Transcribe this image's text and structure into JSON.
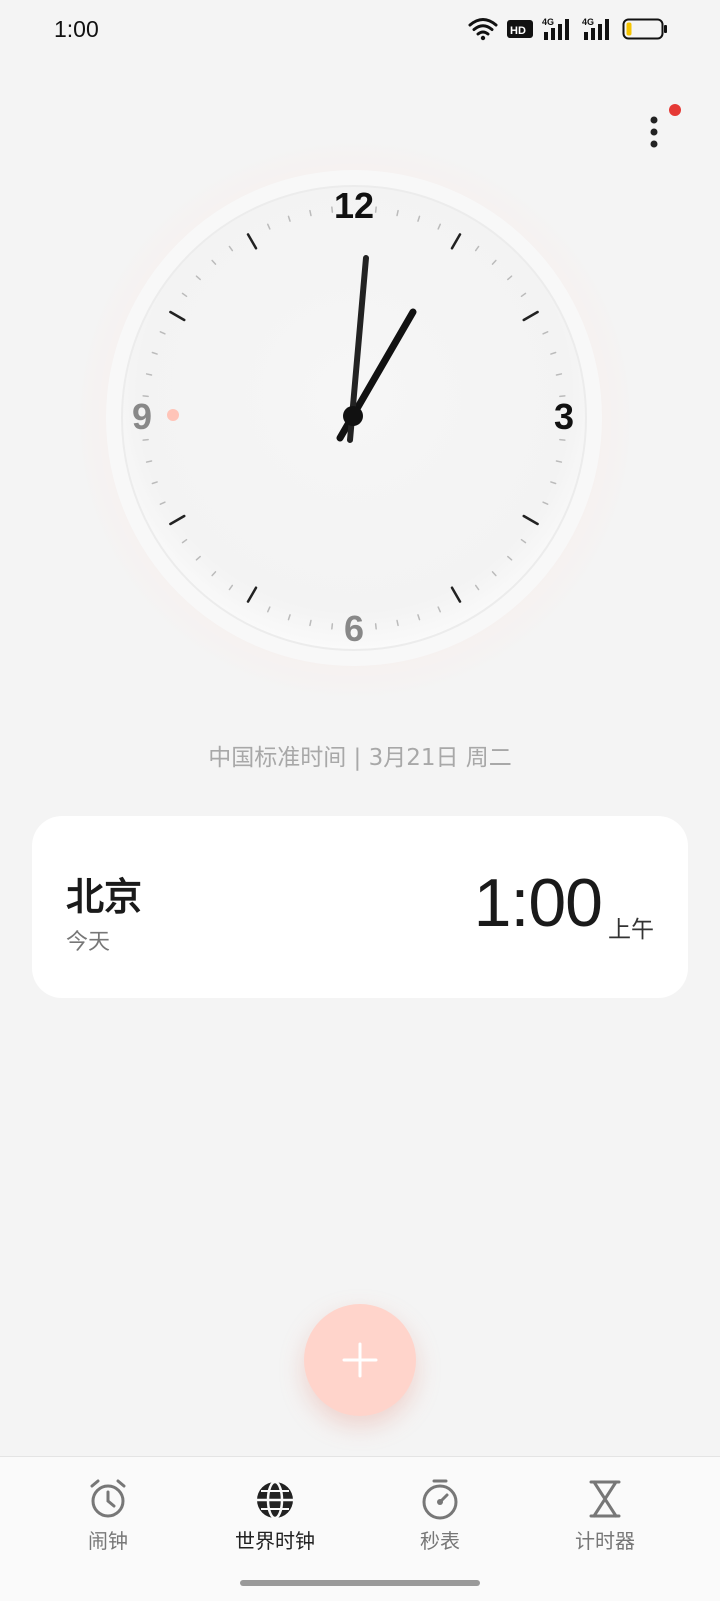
{
  "status_bar": {
    "time": "1:00",
    "icons": [
      "wifi-icon",
      "hd-icon",
      "signal-4g-icon",
      "signal-4g-icon",
      "battery-icon"
    ],
    "hd_text": "HD",
    "network_1": "4G",
    "network_2": "4G",
    "battery_color": "#f5c400"
  },
  "menu": {
    "icon": "more-vertical-icon",
    "badge_color": "#e53935"
  },
  "clock": {
    "numerals": {
      "12": "12",
      "3": "3",
      "6": "6",
      "9": "9"
    },
    "time": "1:00",
    "accent_dot_color": "#ffc4b8"
  },
  "subtitle": "中国标准时间 | 3月21日  周二",
  "city_card": {
    "city": "北京",
    "day": "今天",
    "time": "1:00",
    "ampm": "上午"
  },
  "fab": {
    "icon": "plus-icon",
    "color": "#ffd4cb"
  },
  "bottom_nav": {
    "items": [
      {
        "label": "闹钟",
        "icon": "alarm-clock-icon",
        "active": false
      },
      {
        "label": "世界时钟",
        "icon": "globe-icon",
        "active": true
      },
      {
        "label": "秒表",
        "icon": "stopwatch-icon",
        "active": false
      },
      {
        "label": "计时器",
        "icon": "hourglass-icon",
        "active": false
      }
    ]
  }
}
